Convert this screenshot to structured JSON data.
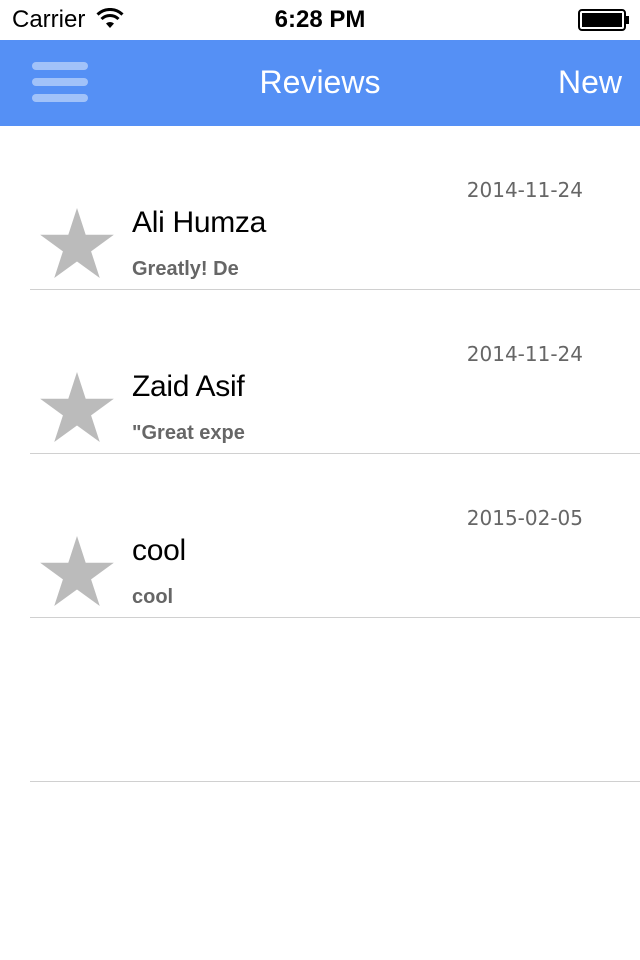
{
  "status_bar": {
    "carrier": "Carrier",
    "time": "6:28 PM",
    "icons": [
      "wifi-icon",
      "battery-icon"
    ]
  },
  "nav_bar": {
    "menu_icon": "hamburger-menu-icon",
    "title": "Reviews",
    "new_label": "New",
    "color": "#5590f5"
  },
  "reviews": [
    {
      "name": "Ali Humza",
      "snippet": "Greatly! De",
      "date": "2014-11-24",
      "icon": "star-icon"
    },
    {
      "name": "Zaid Asif",
      "snippet": "\"Great expe",
      "date": "2014-11-24",
      "icon": "star-icon"
    },
    {
      "name": "cool",
      "snippet": "cool",
      "date": "2015-02-05",
      "icon": "star-icon"
    }
  ],
  "colors": {
    "star": "#bbbbbb",
    "divider": "#d0d0d0",
    "secondary_text": "#666666"
  }
}
